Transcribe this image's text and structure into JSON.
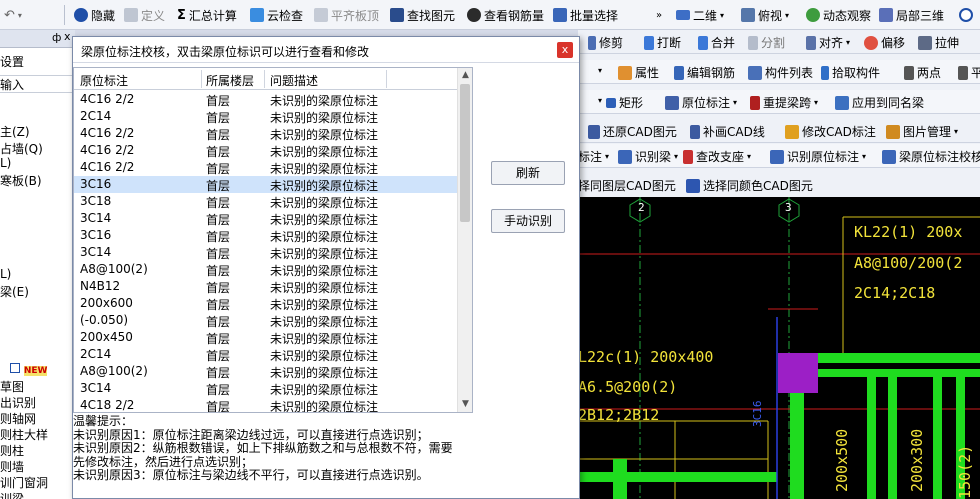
{
  "toolbar": {
    "undo_icon": "undo-icon",
    "items": [
      {
        "label": "隐藏",
        "icon": "eye-icon",
        "disabled": false
      },
      {
        "label": "定义",
        "icon": "define-icon",
        "disabled": true
      },
      {
        "label": "汇总计算",
        "icon": "sigma-icon",
        "disabled": false
      },
      {
        "label": "云检查",
        "icon": "cloud-check-icon",
        "disabled": false
      },
      {
        "label": "平齐板顶",
        "icon": "align-top-icon",
        "disabled": true
      },
      {
        "label": "查找图元",
        "icon": "binoculars-icon",
        "disabled": false
      },
      {
        "label": "查看钢筋量",
        "icon": "rebar-qty-icon",
        "disabled": false
      },
      {
        "label": "批量选择",
        "icon": "batch-select-icon",
        "disabled": false
      }
    ],
    "overflow_icon": "double-chevron-icon",
    "view_items": [
      {
        "label": "二维",
        "icon": "2d-icon"
      },
      {
        "label": "俯视",
        "icon": "topview-icon"
      },
      {
        "label": "动态观察",
        "icon": "orbit-icon"
      },
      {
        "label": "局部三维",
        "icon": "local-3d-icon"
      }
    ]
  },
  "left_panel": {
    "header_pin": "ф",
    "items": [
      "设置",
      "输入",
      "主(Z)",
      "占墙(Q)",
      "L)",
      "寒板(B)",
      "L)",
      "梁(E)",
      "草图",
      "出识别",
      "则轴网",
      "则柱大样",
      "则柱",
      "则墙",
      "训门窗洞",
      "训梁"
    ],
    "new_badge": "NEW"
  },
  "right_toolbars": [
    [
      {
        "label": "修剪",
        "icon": "trim-icon"
      },
      {
        "label": "打断",
        "icon": "break-icon"
      },
      {
        "label": "合并",
        "icon": "merge-icon"
      },
      {
        "label": "分割",
        "icon": "split-icon"
      },
      {
        "label": "对齐",
        "icon": "align-icon"
      },
      {
        "label": "偏移",
        "icon": "offset-icon"
      },
      {
        "label": "拉伸",
        "icon": "stretch-icon"
      }
    ],
    [
      {
        "label": "属性",
        "icon": "property-icon"
      },
      {
        "label": "编辑钢筋",
        "icon": "edit-rebar-icon"
      },
      {
        "label": "构件列表",
        "icon": "component-list-icon"
      },
      {
        "label": "拾取构件",
        "icon": "pick-component-icon"
      },
      {
        "label": "两点",
        "icon": "two-point-icon"
      },
      {
        "label": "平",
        "icon": "parallel-icon"
      }
    ],
    [
      {
        "label": "矩形",
        "icon": "rectangle-icon"
      },
      {
        "label": "原位标注",
        "icon": "in-situ-mark-icon"
      },
      {
        "label": "重提梁跨",
        "icon": "re-span-icon"
      },
      {
        "label": "应用到同名梁",
        "icon": "apply-same-icon"
      }
    ],
    [
      {
        "label": "还原CAD图元",
        "icon": "restore-cad-icon"
      },
      {
        "label": "补画CAD线",
        "icon": "draw-cad-line-icon"
      },
      {
        "label": "修改CAD标注",
        "icon": "edit-cad-mark-icon"
      },
      {
        "label": "图片管理",
        "icon": "image-manage-icon"
      }
    ],
    [
      {
        "label": "标注",
        "icon": "mark-icon"
      },
      {
        "label": "识别梁",
        "icon": "recognize-beam-icon"
      },
      {
        "label": "查改支座",
        "icon": "support-icon"
      },
      {
        "label": "识别原位标注",
        "icon": "recognize-mark-icon"
      },
      {
        "label": "梁原位标注校核",
        "icon": "check-mark-icon"
      }
    ],
    [
      {
        "label": "择同图层CAD图元",
        "icon": "same-layer-icon"
      },
      {
        "label": "选择同颜色CAD图元",
        "icon": "same-color-icon"
      }
    ]
  ],
  "cad": {
    "axis_2": "2",
    "axis_3": "3",
    "text_kl22": "KL22(1) 200x",
    "text_a8": "A8@100/200(2",
    "text_2c14": "2C14;2C18",
    "text_l22c": "L22c(1) 200x400",
    "text_a6": "A6.5@200(2)",
    "text_2b12": "2B12;2B12",
    "text_3c16": "3C16",
    "text_200x500": "200x500",
    "text_200x300": "200x300",
    "text_150": "150(2)"
  },
  "dialog": {
    "title": "梁原位标注校核，双击梁原位标识可以进行查看和修改",
    "close_label": "x",
    "columns": [
      "原位标注",
      "所属楼层",
      "问题描述"
    ],
    "rows": [
      [
        "4C16 2/2",
        "首层",
        "未识别的梁原位标注"
      ],
      [
        "2C14",
        "首层",
        "未识别的梁原位标注"
      ],
      [
        "4C16 2/2",
        "首层",
        "未识别的梁原位标注"
      ],
      [
        "4C16 2/2",
        "首层",
        "未识别的梁原位标注"
      ],
      [
        "4C16 2/2",
        "首层",
        "未识别的梁原位标注"
      ],
      [
        "3C16",
        "首层",
        "未识别的梁原位标注"
      ],
      [
        "3C18",
        "首层",
        "未识别的梁原位标注"
      ],
      [
        "3C14",
        "首层",
        "未识别的梁原位标注"
      ],
      [
        "3C16",
        "首层",
        "未识别的梁原位标注"
      ],
      [
        "3C14",
        "首层",
        "未识别的梁原位标注"
      ],
      [
        "A8@100(2)",
        "首层",
        "未识别的梁原位标注"
      ],
      [
        "N4B12",
        "首层",
        "未识别的梁原位标注"
      ],
      [
        "200x600",
        "首层",
        "未识别的梁原位标注"
      ],
      [
        "(-0.050)",
        "首层",
        "未识别的梁原位标注"
      ],
      [
        "200x450",
        "首层",
        "未识别的梁原位标注"
      ],
      [
        "2C14",
        "首层",
        "未识别的梁原位标注"
      ],
      [
        "A8@100(2)",
        "首层",
        "未识别的梁原位标注"
      ],
      [
        "3C14",
        "首层",
        "未识别的梁原位标注"
      ],
      [
        "4C18 2/2",
        "首层",
        "未识别的梁原位标注"
      ]
    ],
    "selected_index": 5,
    "refresh_label": "刷新",
    "manual_label": "手动识别",
    "tips": [
      "温馨提示：",
      "未识别原因1：原位标注距离梁边线过远，可以直接进行点选识别；",
      "未识别原因2：纵筋根数错误，如上下排纵筋数之和与总根数不符，需要",
      "先修改标注，然后进行点选识别；",
      "未识别原因3：原位标注与梁边线不平行，可以直接进行点选识别。"
    ]
  }
}
